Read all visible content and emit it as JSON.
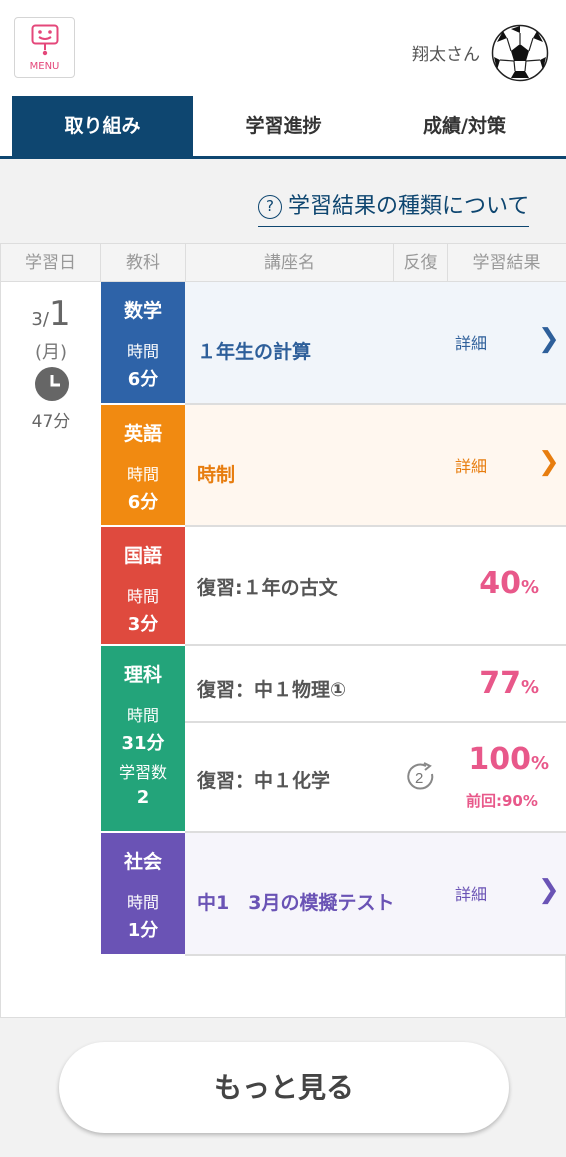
{
  "header": {
    "menu_label": "MENU",
    "user_name": "翔太さん",
    "menu_icon_color": "#e4477a"
  },
  "tabs": [
    {
      "label": "取り組み",
      "active": true
    },
    {
      "label": "学習進捗",
      "active": false
    },
    {
      "label": "成績/対策",
      "active": false
    }
  ],
  "info_link": {
    "icon": "?",
    "label": "学習結果の種類について"
  },
  "table": {
    "headers": [
      "学習日",
      "教科",
      "講座名",
      "反復",
      "学習結果"
    ],
    "date": {
      "month": "3/",
      "day": "1",
      "weekday": "(月)",
      "total_time": "47分"
    },
    "subjects": [
      {
        "name": "数学",
        "time_label": "時間",
        "time": "6分",
        "color": "#2e63a8"
      },
      {
        "name": "英語",
        "time_label": "時間",
        "time": "6分",
        "color": "#f18a11"
      },
      {
        "name": "国語",
        "time_label": "時間",
        "time": "3分",
        "color": "#df4a3e"
      },
      {
        "name": "理科",
        "time_label": "時間",
        "time": "31分",
        "count_label": "学習数",
        "count": "2",
        "color": "#23a47a"
      },
      {
        "name": "社会",
        "time_label": "時間",
        "time": "1分",
        "color": "#6a53b5"
      }
    ],
    "rows": [
      {
        "course": "１年生の計算",
        "detail": "詳細",
        "chevron": "❯",
        "text_color": "#2e5f9a",
        "bg": "#f1f5fa"
      },
      {
        "course": "時制",
        "detail": "詳細",
        "chevron": "❯",
        "text_color": "#e77d0f",
        "bg": "#fff7ef"
      },
      {
        "course": "復習:１年の古文",
        "score": "40",
        "pct": "%",
        "bg": "#ffffff"
      },
      {
        "course": "復習：中１物理①",
        "score": "77",
        "pct": "%",
        "bg": "#ffffff"
      },
      {
        "course": "復習：中１化学",
        "review_count": "2",
        "score": "100",
        "pct": "%",
        "prev": "前回:90%",
        "bg": "#ffffff"
      },
      {
        "course": "中1　3月の模擬テスト",
        "detail": "詳細",
        "chevron": "❯",
        "text_color": "#6a53b5",
        "bg": "#f6f5fb"
      }
    ]
  },
  "more_button": "もっと見る"
}
